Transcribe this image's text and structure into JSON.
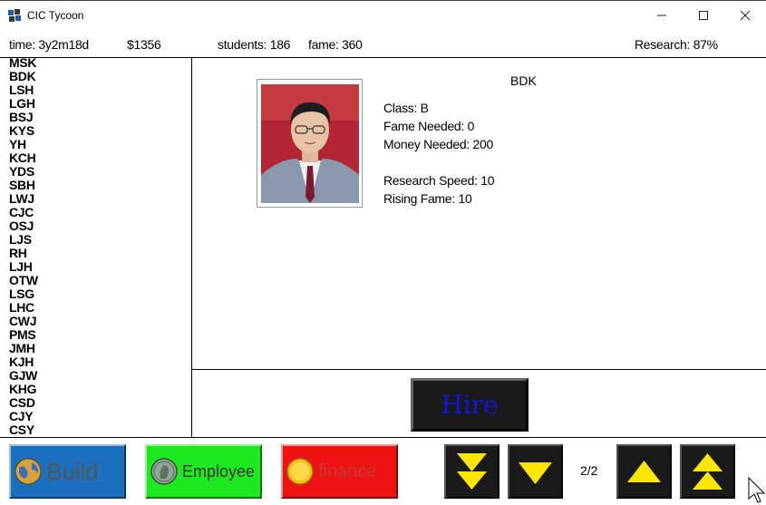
{
  "window": {
    "title": "CIC Tycoon",
    "icon": "app-icon"
  },
  "status": {
    "time": "time: 3y2m18d",
    "money": "$1356",
    "students": "students: 186",
    "fame": "fame: 360",
    "research": "Research: 87%"
  },
  "professors": [
    "MSK",
    "BDK",
    "LSH",
    "LGH",
    "BSJ",
    "KYS",
    "YH",
    "KCH",
    "YDS",
    "SBH",
    "LWJ",
    "CJC",
    "OSJ",
    "LJS",
    "RH",
    "LJH",
    "OTW",
    "LSG",
    "LHC",
    "CWJ",
    "PMS",
    "JMH",
    "KJH",
    "GJW",
    "KHG",
    "CSD",
    "CJY",
    "CSY"
  ],
  "detail": {
    "name": "BDK",
    "class": "Class: B",
    "fame_needed": "Fame Needed: 0",
    "money_needed": "Money Needed: 200",
    "research_speed": "Research Speed: 10",
    "rising_fame": "Rising Fame: 10",
    "photo_icon": "professor-portrait"
  },
  "hire_label": "Hire",
  "toolbar": {
    "build": "Build",
    "employee": "Employee",
    "finance": "finance",
    "page": "2/2",
    "colors": {
      "build": "#1c6fbf",
      "employee": "#1ee81e",
      "finance": "#ee1212",
      "arrow": "#ffe600",
      "hire_text": "#1515e0"
    }
  }
}
